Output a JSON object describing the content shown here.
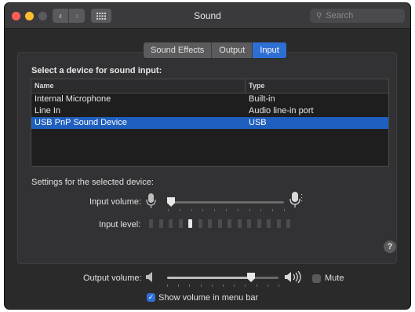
{
  "window": {
    "title": "Sound"
  },
  "toolbar": {
    "back_icon": "chevron-left-icon",
    "forward_icon": "chevron-right-icon",
    "grid_icon": "grid-icon"
  },
  "search": {
    "placeholder": "Search"
  },
  "tabs": [
    {
      "label": "Sound Effects",
      "active": false
    },
    {
      "label": "Output",
      "active": false
    },
    {
      "label": "Input",
      "active": true
    }
  ],
  "input_section": {
    "heading": "Select a device for sound input:",
    "columns": {
      "name": "Name",
      "type": "Type"
    },
    "devices": [
      {
        "name": "Internal Microphone",
        "type": "Built-in",
        "selected": false
      },
      {
        "name": "Line In",
        "type": "Audio line-in port",
        "selected": false
      },
      {
        "name": "USB PnP Sound Device",
        "type": "USB",
        "selected": true
      }
    ]
  },
  "settings": {
    "heading": "Settings for the selected device:",
    "input_volume_label": "Input volume:",
    "input_volume_value": 0.03,
    "input_level_label": "Input level:",
    "input_level_active_segment": 5,
    "input_level_segments": 15
  },
  "output": {
    "volume_label": "Output volume:",
    "volume_value": 0.75,
    "mute_label": "Mute",
    "mute_checked": false,
    "show_in_menu_bar_label": "Show volume in menu bar",
    "show_in_menu_bar_checked": true
  },
  "colors": {
    "accent": "#2e6fd4",
    "selection": "#1f5fbf",
    "window_bg": "#2a2a2a"
  }
}
